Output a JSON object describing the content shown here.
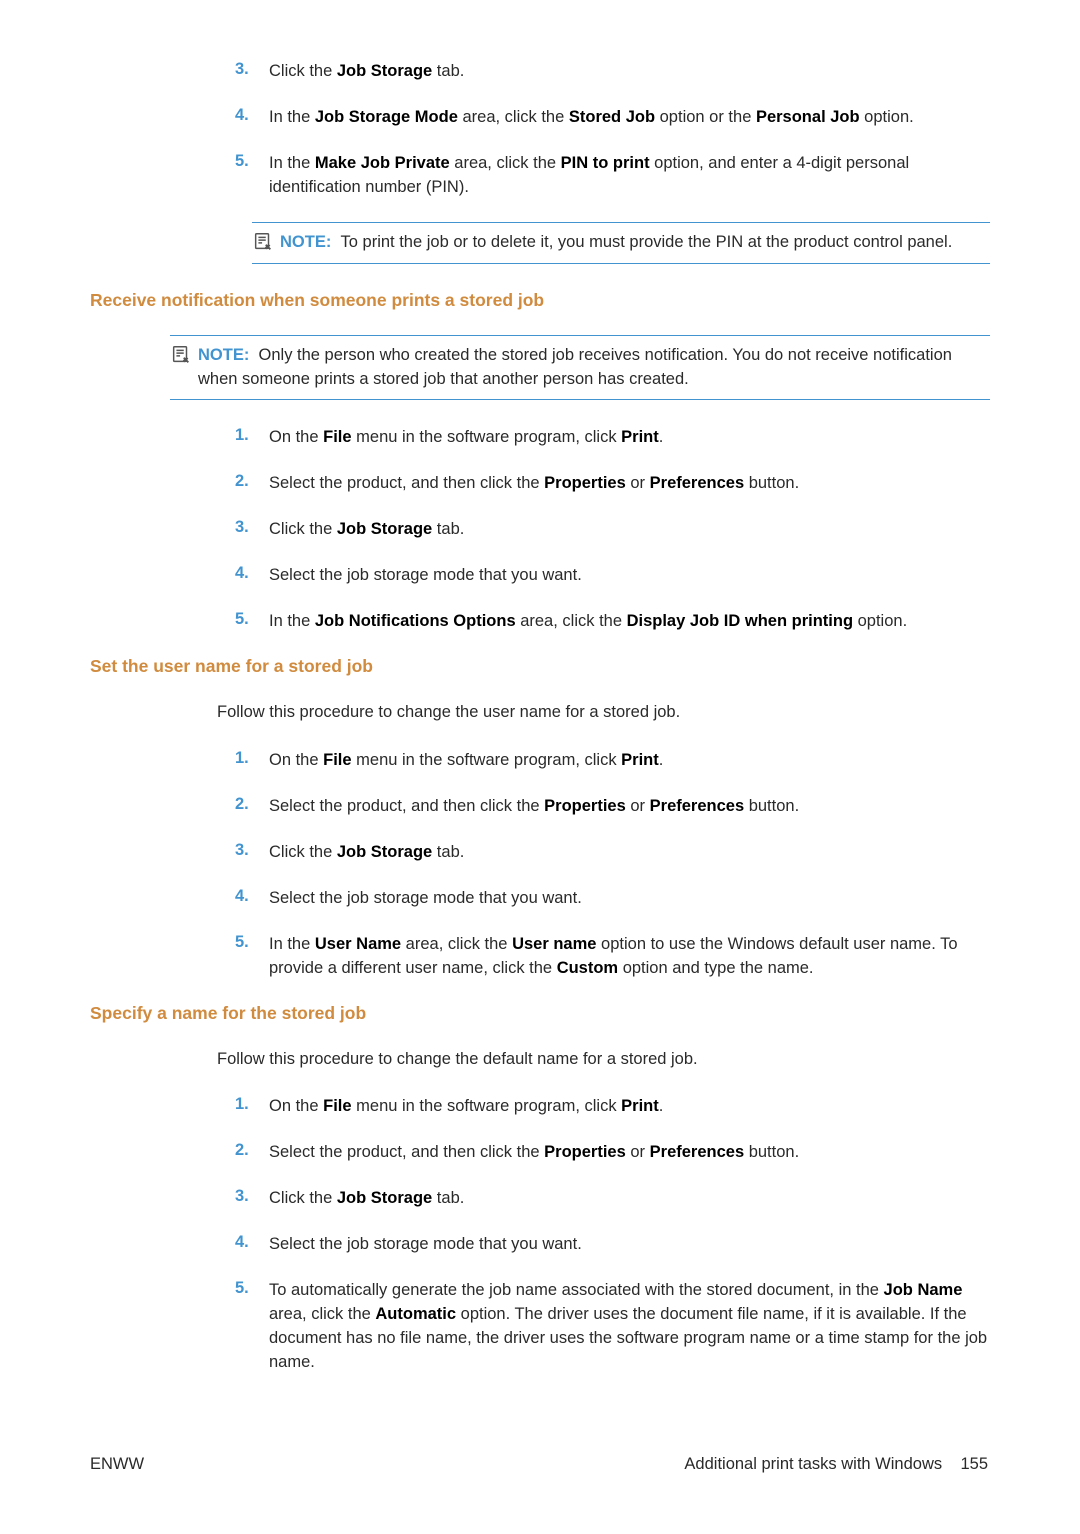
{
  "section_top": {
    "items": [
      {
        "n": "3.",
        "html": "Click the <b>Job Storage</b> tab."
      },
      {
        "n": "4.",
        "html": "In the <b>Job Storage Mode</b> area, click the <b>Stored Job</b> option or the <b>Personal Job</b> option."
      },
      {
        "n": "5.",
        "html": "In the <b>Make Job Private</b> area, click the <b>PIN to print</b> option, and enter a 4-digit personal identification number (PIN)."
      }
    ],
    "note": "To print the job or to delete it, you must provide the PIN at the product control panel."
  },
  "section_receive": {
    "heading": "Receive notification when someone prints a stored job",
    "note": "Only the person who created the stored job receives notification. You do not receive notification when someone prints a stored job that another person has created.",
    "items": [
      {
        "n": "1.",
        "html": "On the <b>File</b> menu in the software program, click <b>Print</b>."
      },
      {
        "n": "2.",
        "html": "Select the product, and then click the <b>Properties</b> or <b>Preferences</b> button."
      },
      {
        "n": "3.",
        "html": "Click the <b>Job Storage</b> tab."
      },
      {
        "n": "4.",
        "html": "Select the job storage mode that you want."
      },
      {
        "n": "5.",
        "html": "In the <b>Job Notifications Options</b> area, click the <b>Display Job ID when printing</b> option."
      }
    ]
  },
  "section_username": {
    "heading": "Set the user name for a stored job",
    "intro": "Follow this procedure to change the user name for a stored job.",
    "items": [
      {
        "n": "1.",
        "html": "On the <b>File</b> menu in the software program, click <b>Print</b>."
      },
      {
        "n": "2.",
        "html": "Select the product, and then click the <b>Properties</b> or <b>Preferences</b> button."
      },
      {
        "n": "3.",
        "html": "Click the <b>Job Storage</b> tab."
      },
      {
        "n": "4.",
        "html": "Select the job storage mode that you want."
      },
      {
        "n": "5.",
        "html": "In the <b>User Name</b> area, click the <b>User name</b> option to use the Windows default user name. To provide a different user name, click the <b>Custom</b> option and type the name."
      }
    ]
  },
  "section_specify": {
    "heading": "Specify a name for the stored job",
    "intro": "Follow this procedure to change the default name for a stored job.",
    "items": [
      {
        "n": "1.",
        "html": "On the <b>File</b> menu in the software program, click <b>Print</b>."
      },
      {
        "n": "2.",
        "html": "Select the product, and then click the <b>Properties</b> or <b>Preferences</b> button."
      },
      {
        "n": "3.",
        "html": "Click the <b>Job Storage</b> tab."
      },
      {
        "n": "4.",
        "html": "Select the job storage mode that you want."
      },
      {
        "n": "5.",
        "html": "To automatically generate the job name associated with the stored document, in the <b>Job Name</b> area, click the <b>Automatic</b> option. The driver uses the document file name, if it is available. If the document has no file name, the driver uses the software program name or a time stamp for the job name."
      }
    ]
  },
  "note_label": "NOTE:",
  "footer": {
    "left": "ENWW",
    "right_text": "Additional print tasks with Windows",
    "right_page": "155"
  }
}
